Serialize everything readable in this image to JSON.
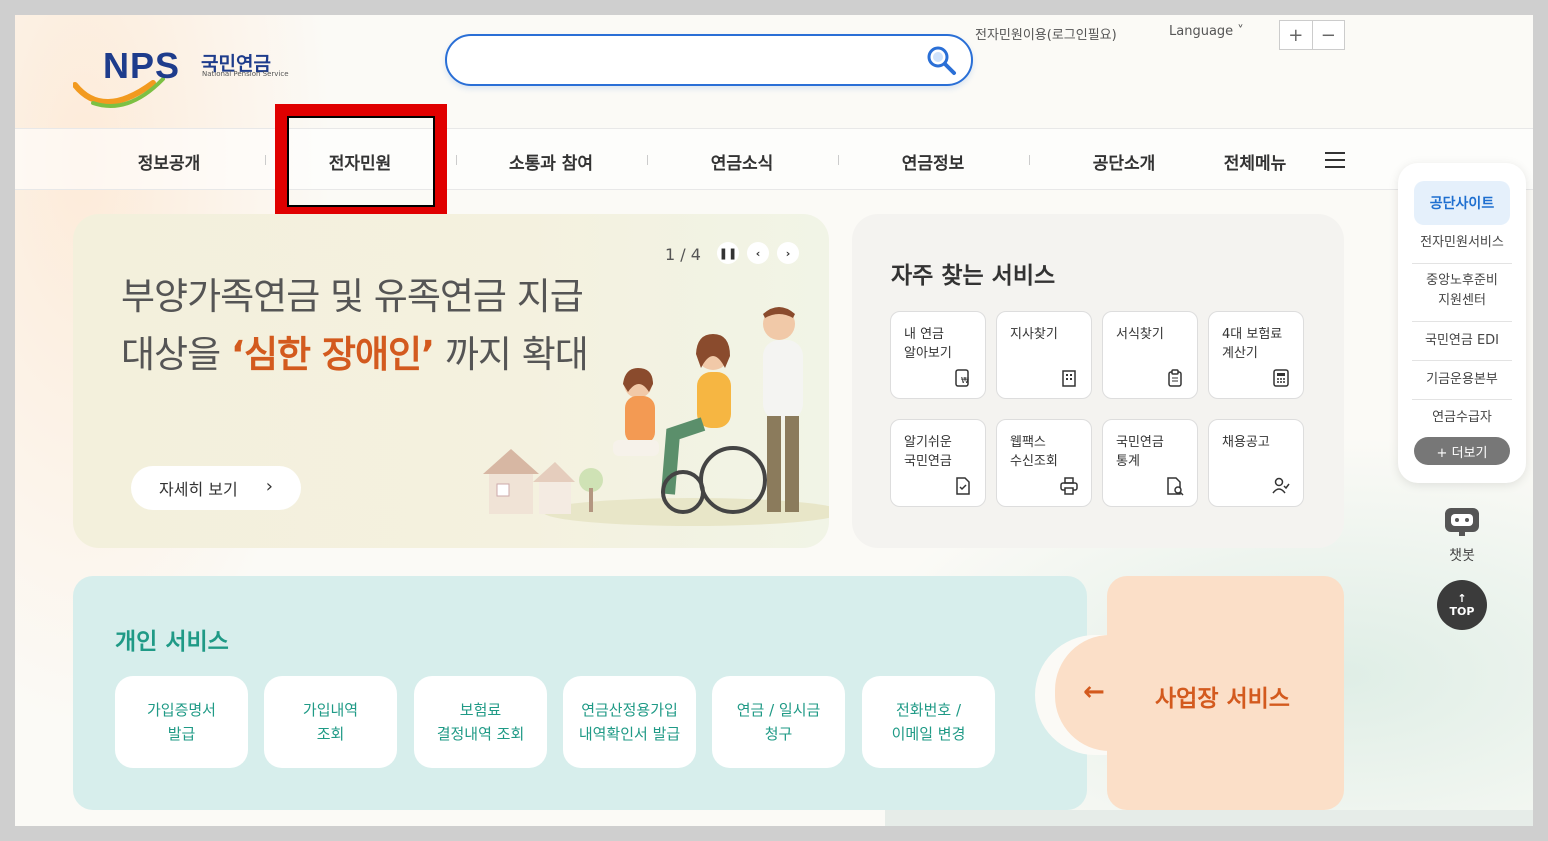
{
  "header": {
    "logo_text": "NPS",
    "logo_korean": "국민연금",
    "logo_english": "National Pension Service",
    "search_placeholder": "",
    "util_minwon": "전자민원이용(로그인필요)",
    "util_language": "Language",
    "zoom_in": "+",
    "zoom_out": "−"
  },
  "nav": {
    "items": [
      "정보공개",
      "전자민원",
      "소통과 참여",
      "연금소식",
      "연금정보",
      "공단소개",
      "전체메뉴"
    ]
  },
  "banner": {
    "line1": "부양가족연금 및 유족연금 지급",
    "line2_pre": "대상을 ",
    "line2_highlight": "‘심한 장애인’",
    "line2_post": " 까지 확대",
    "counter": "1 / 4",
    "more_label": "자세히 보기"
  },
  "quick": {
    "title": "자주 찾는 서비스",
    "items": [
      {
        "label": "내 연금\n알아보기",
        "icon": "document-won-icon"
      },
      {
        "label": "지사찾기",
        "icon": "building-icon"
      },
      {
        "label": "서식찾기",
        "icon": "clipboard-icon"
      },
      {
        "label": "4대 보험료\n계산기",
        "icon": "calculator-icon"
      },
      {
        "label": "알기쉬운\n국민연금",
        "icon": "document-check-icon"
      },
      {
        "label": "웹팩스\n수신조회",
        "icon": "printer-icon"
      },
      {
        "label": "국민연금\n통계",
        "icon": "document-search-icon"
      },
      {
        "label": "채용공고",
        "icon": "person-check-icon"
      }
    ]
  },
  "personal": {
    "title": "개인 서비스",
    "items": [
      [
        "가입증명서",
        "발급"
      ],
      [
        "가입내역",
        "조회"
      ],
      [
        "보험료",
        "결정내역 조회"
      ],
      [
        "연금산정용가입",
        "내역확인서 발급"
      ],
      [
        "연금 / 일시금",
        "청구"
      ],
      [
        "전화번호 /",
        "이메일 변경"
      ]
    ]
  },
  "business": {
    "label": "사업장 서비스"
  },
  "side": {
    "head": "공단사이트",
    "items": [
      "전자민원서비스",
      "중앙노후준비\n지원센터",
      "국민연금 EDI",
      "기금운용본부",
      "연금수급자"
    ],
    "more": "+ 더보기",
    "chatbot": "챗봇",
    "top": "TOP"
  },
  "colors": {
    "primary_blue": "#1e3c8c",
    "search_border": "#2a6fd6",
    "accent_orange": "#d35a1e",
    "teal": "#1f9a86",
    "highlight_red": "#e00000"
  }
}
